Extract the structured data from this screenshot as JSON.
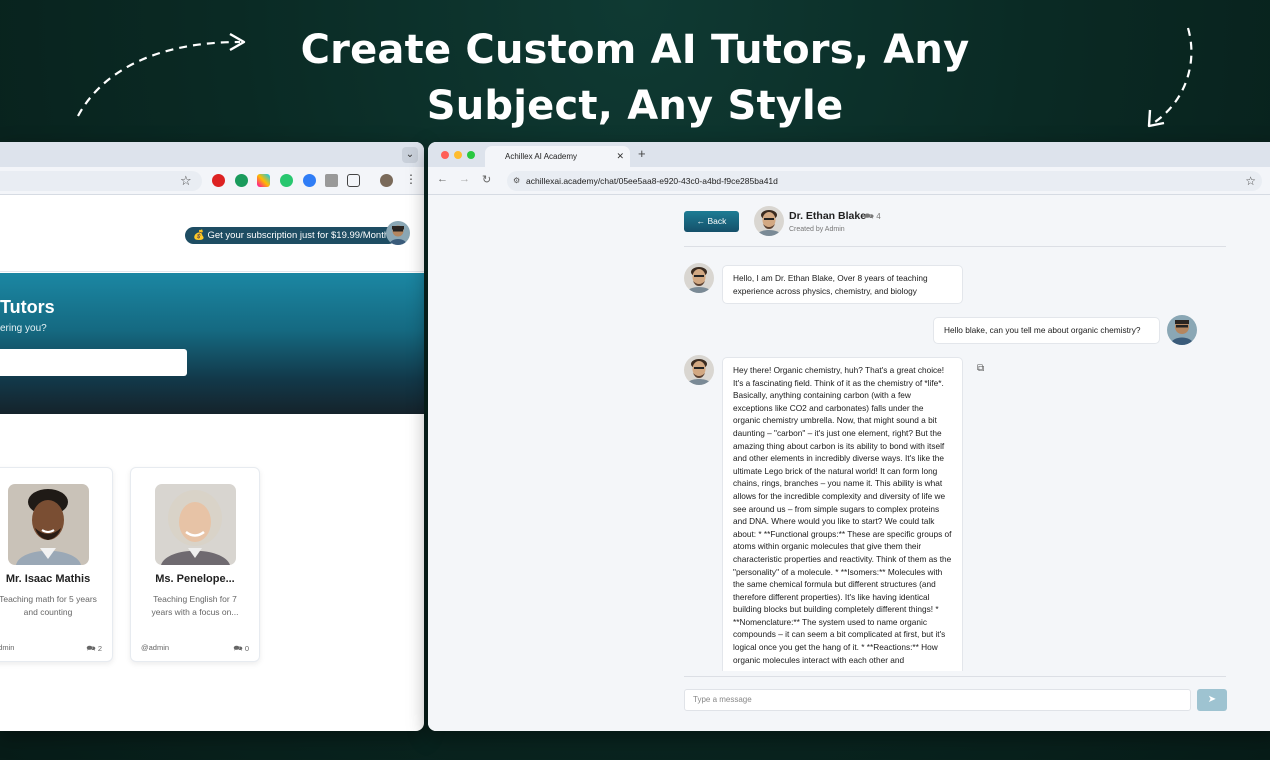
{
  "headline": {
    "line1": "Create Custom AI Tutors, Any",
    "line2": "Subject, Any Style"
  },
  "left_window": {
    "subscription_badge": "💰 Get your subscription just for $19.99/Month",
    "hero": {
      "title": "Tutors",
      "subtitle": "ering you?"
    },
    "cards": [
      {
        "name": "Mr. Isaac Mathis",
        "description": "Teaching math for 5 years and counting",
        "creator": "admin",
        "count": "2"
      },
      {
        "name": "Ms. Penelope...",
        "description": "Teaching English for 7 years with a focus on...",
        "creator": "@admin",
        "count": "0"
      }
    ]
  },
  "right_window": {
    "tab_title": "Achillex AI Academy",
    "url": "achillexai.academy/chat/05ee5aa8-e920-43c0-a4bd-f9ce285ba41d",
    "chat": {
      "back_label": "Back",
      "tutor_name": "Dr. Ethan Blake",
      "tutor_count": "4",
      "creator_line": "Created by Admin",
      "messages": [
        {
          "role": "tutor",
          "text": "Hello, I am Dr. Ethan Blake, Over 8 years of teaching experience across physics, chemistry, and biology"
        },
        {
          "role": "user",
          "text": "Hello blake, can you tell me about organic chemistry?"
        },
        {
          "role": "tutor",
          "text": "Hey there! Organic chemistry, huh? That's a great choice! It's a fascinating field. Think of it as the chemistry of *life*. Basically, anything containing carbon (with a few exceptions like CO2 and carbonates) falls under the organic chemistry umbrella. Now, that might sound a bit daunting – \"carbon\" – it's just one element, right? But the amazing thing about carbon is its ability to bond with itself and other elements in incredibly diverse ways. It's like the ultimate Lego brick of the natural world! It can form long chains, rings, branches – you name it. This ability is what allows for the incredible complexity and diversity of life we see around us – from simple sugars to complex proteins and DNA. Where would you like to start? We could talk about: * **Functional groups:** These are specific groups of atoms within organic molecules that give them their characteristic properties and reactivity. Think of them as the \"personality\" of a molecule. * **Isomers:** Molecules with the same chemical formula but different structures (and therefore different properties). It's like having identical building blocks but building completely different things! * **Nomenclature:** The system used to name organic compounds – it can seem a bit complicated at first, but it's logical once you get the hang of it. * **Reactions:** How organic molecules interact with each other and"
        }
      ],
      "input_placeholder": "Type a message"
    }
  },
  "colors": {
    "background": "#0a2a24",
    "accent": "#1d7c94",
    "send_button": "#9ec3d1"
  }
}
